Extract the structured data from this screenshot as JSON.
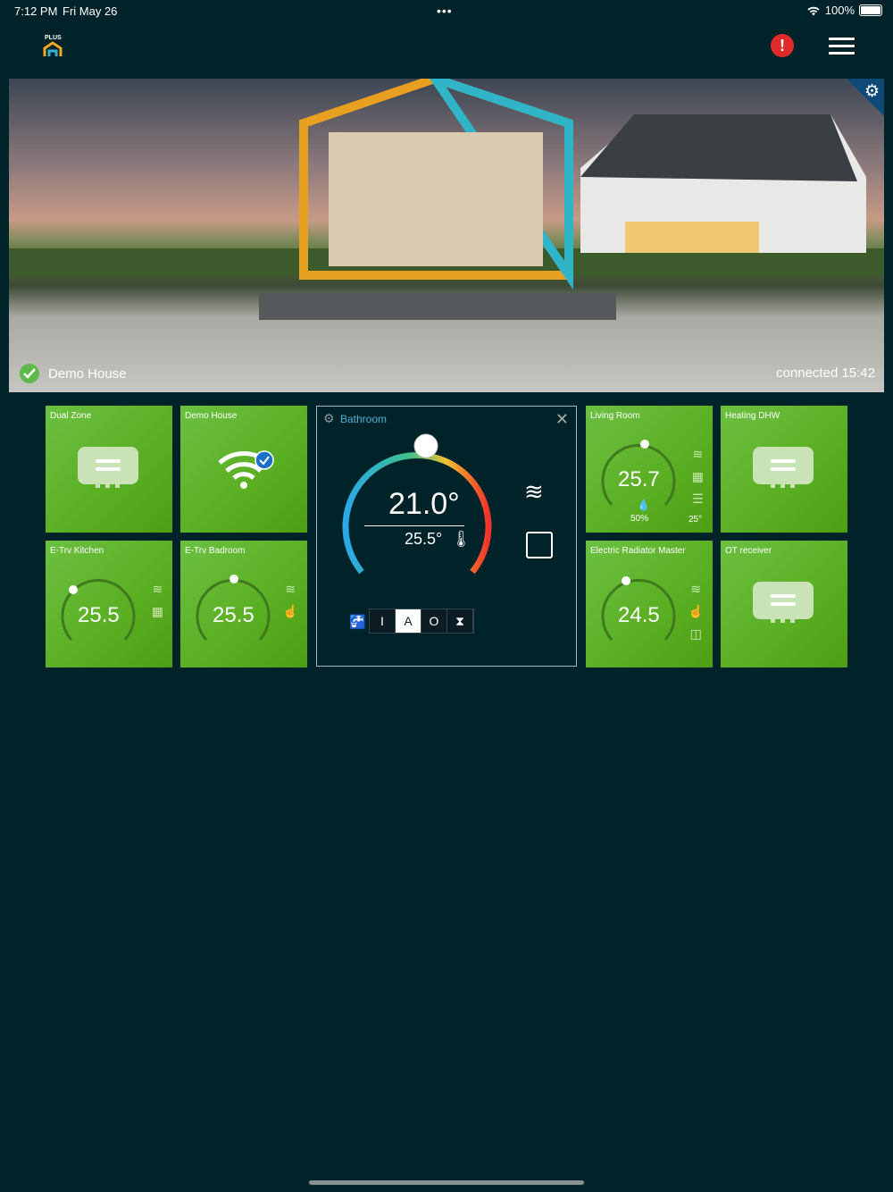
{
  "status": {
    "time": "7:12 PM",
    "date": "Fri May 26",
    "dots": "•••",
    "battery": "100%"
  },
  "app": {
    "logo_text": "PLUS"
  },
  "hero": {
    "house_name": "Demo House",
    "connection": "connected 15:42"
  },
  "tiles": [
    {
      "title": "Dual Zone",
      "type": "gateway"
    },
    {
      "title": "Demo House",
      "type": "wifi"
    },
    {
      "title": "Living Room",
      "value": "25.7",
      "humidity": "50%",
      "floor": "25°",
      "knob": 0.5
    },
    {
      "title": "Heating DHW",
      "type": "gateway"
    },
    {
      "title": "E-Trv Kitchen",
      "value": "25.5",
      "knob": 0.15
    },
    {
      "title": "E-Trv Badroom",
      "value": "25.5",
      "knob": 0.5
    },
    {
      "title": "Electric Radiator Master",
      "value": "24.5",
      "knob": 0.3
    },
    {
      "title": "OT receiver",
      "type": "gateway"
    }
  ],
  "modal": {
    "title": "Bathroom",
    "setpoint": "21.0°",
    "room_temp": "25.5°",
    "modes": [
      {
        "label": "I",
        "active": false
      },
      {
        "label": "A",
        "active": true
      },
      {
        "label": "O",
        "active": false
      },
      {
        "label": "⧗",
        "active": false
      }
    ]
  },
  "colors": {
    "background": "#002329",
    "tile": "#5aae22",
    "alert": "#e02b2b",
    "accent": "#4db0d8"
  },
  "icons": [
    "wifi-icon",
    "battery-icon",
    "logo-icon",
    "alert-icon",
    "menu-icon",
    "gear-icon",
    "check-icon",
    "heat-icon",
    "calendar-icon",
    "hand-icon",
    "radiator-icon",
    "tap-icon",
    "close-icon"
  ]
}
